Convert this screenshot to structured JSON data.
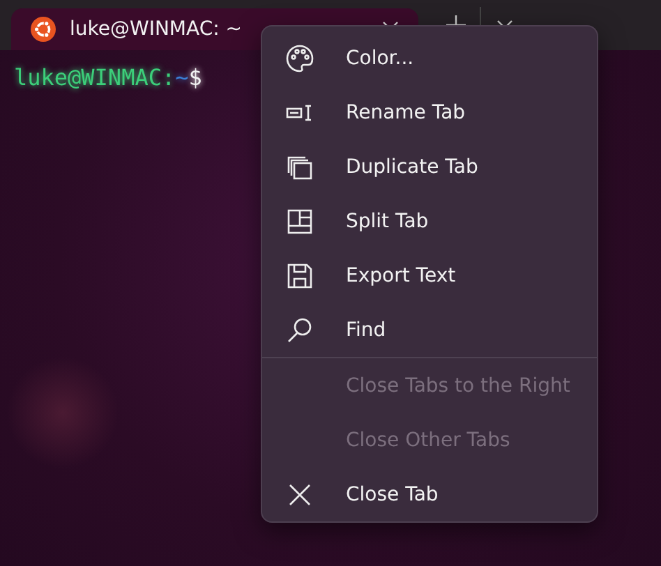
{
  "tab": {
    "title": "luke@WINMAC: ~",
    "selected": true
  },
  "prompt": [
    {
      "text": "luke@WINMAC:",
      "color": "#3ccf7a"
    },
    {
      "text": "~",
      "color": "#3b7fd6"
    },
    {
      "text": "$",
      "color": "#f2f2f2"
    }
  ],
  "menu": [
    {
      "kind": "item",
      "label": "Color...",
      "disabled": false
    },
    {
      "kind": "item",
      "label": "Rename Tab",
      "disabled": false
    },
    {
      "kind": "item",
      "label": "Duplicate Tab",
      "disabled": false
    },
    {
      "kind": "item",
      "label": "Split Tab",
      "disabled": false
    },
    {
      "kind": "item",
      "label": "Export Text",
      "disabled": false
    },
    {
      "kind": "item",
      "label": "Find",
      "disabled": false
    },
    {
      "kind": "separator"
    },
    {
      "kind": "item",
      "label": "Close Tabs to the Right",
      "disabled": true
    },
    {
      "kind": "item",
      "label": "Close Other Tabs",
      "disabled": true
    },
    {
      "kind": "item",
      "label": "Close Tab",
      "disabled": false
    }
  ]
}
